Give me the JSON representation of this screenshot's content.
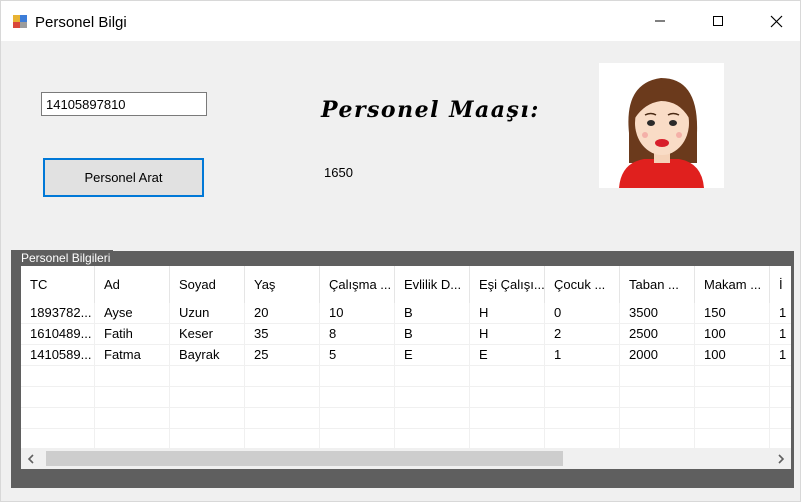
{
  "window": {
    "title": "Personel Bilgi"
  },
  "search": {
    "tc_value": "14105897810",
    "button_label": "Personel Arat"
  },
  "salary": {
    "label": "Personel Maaşı:",
    "value": "1650"
  },
  "personnel_group": {
    "title": "Personel Bilgileri",
    "columns": [
      "TC",
      "Ad",
      "Soyad",
      "Yaş",
      "Çalışma ...",
      "Evlilik D...",
      "Eşi Çalışı...",
      "Çocuk ...",
      "Taban ...",
      "Makam ...",
      "İ"
    ],
    "rows": [
      [
        "1893782...",
        "Ayse",
        "Uzun",
        "20",
        "10",
        "B",
        "H",
        "0",
        "3500",
        "150",
        "1"
      ],
      [
        "1610489...",
        "Fatih",
        "Keser",
        "35",
        "8",
        "B",
        "H",
        "2",
        "2500",
        "100",
        "1"
      ],
      [
        "1410589...",
        "Fatma",
        "Bayrak",
        "25",
        "5",
        "E",
        "E",
        "1",
        "2000",
        "100",
        "1"
      ]
    ]
  },
  "icons": {
    "app": "app-icon",
    "minimize": "minimize-icon",
    "maximize": "maximize-icon",
    "close": "close-icon",
    "scroll_left": "chevron-left-icon",
    "scroll_right": "chevron-right-icon"
  },
  "colors": {
    "accent": "#0078d7",
    "groupbox": "#5f5f5f",
    "window_bg": "#f0f0f0"
  }
}
